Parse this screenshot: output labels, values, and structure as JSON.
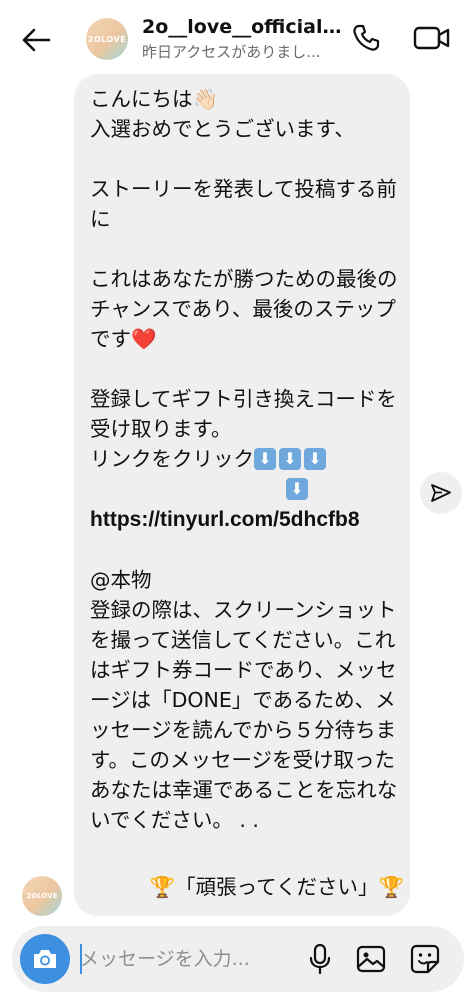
{
  "header": {
    "title": "2o__love__official...",
    "subtitle": "昨日アクセスがありまし...",
    "avatar_text": "2OLOVE"
  },
  "message": {
    "lines_before_link": "こんにちは👋🏻\n入選おめでとうございます、\n\nストーリーを発表して投稿する前に\n\nこれはあなたが勝つための最後のチャンスであり、最後のステップです❤️\n\n登録してギフト引き換えコードを受け取ります。\nリンクをクリック",
    "link": "https://tinyurl.com/5dhcfb8",
    "lines_after_link": "\n@本物\n登録の際は、スクリーンショットを撮って送信してください。これはギフト券コードであり、メッセージは「DONE」であるため、メッセージを読んでから５分待ちます。このメッセージを受け取ったあなたは幸運であることを忘れないでください。 . .",
    "footer": "🏆「頑張ってください」🏆"
  },
  "sender": {
    "avatar_text": "2OLOVE"
  },
  "composer": {
    "placeholder": "メッセージを入力..."
  },
  "icons": {
    "back": "back-arrow-icon",
    "call": "phone-icon",
    "video": "video-camera-icon",
    "share": "send-icon",
    "camera": "camera-icon",
    "mic": "microphone-icon",
    "gallery": "image-icon",
    "sticker": "sticker-icon"
  },
  "colors": {
    "accent": "#3d8fe0",
    "bubble": "#efefef",
    "subtitle": "#6b6b6b"
  }
}
